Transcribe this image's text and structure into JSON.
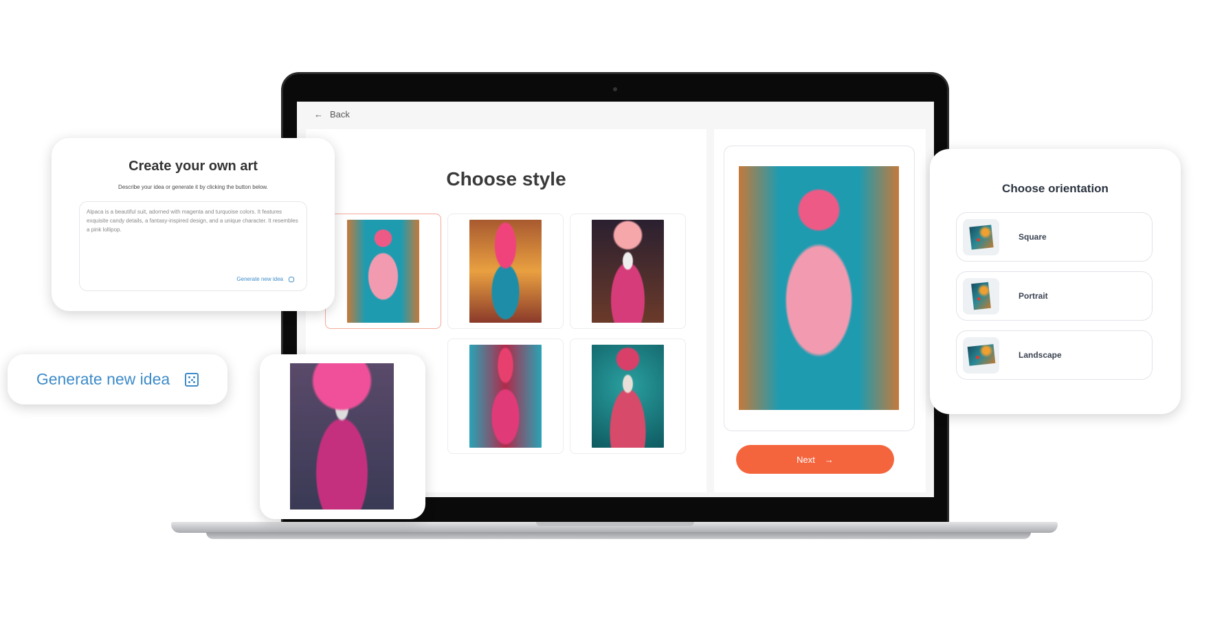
{
  "screen": {
    "back_label": "Back",
    "title": "Choose style",
    "styles": [
      {
        "name": "Candy shop pink alpaca",
        "selected": true
      },
      {
        "name": "Ice cream alpaca in teal suit",
        "selected": false
      },
      {
        "name": "Fluffy alpaca in pink coat",
        "selected": false
      },
      {
        "name": "Pink alpaca in street",
        "selected": false
      },
      {
        "name": "Alpaca with rose hat",
        "selected": false
      }
    ],
    "next_label": "Next",
    "accent_color": "#f5653d"
  },
  "create_card": {
    "title": "Create your own art",
    "subtitle": "Describe your idea or generate it by clicking the button below.",
    "prompt_value": "Alpaca is a beautiful suit, adorned with magenta and turquoise colors. It features exquisite candy details, a fantasy-inspired design, and a unique character. It resembles a pink lollipop.",
    "generate_label": "Generate new idea"
  },
  "generate_pill": {
    "label": "Generate new idea",
    "icon": "dice-icon",
    "color": "#3d8bc9"
  },
  "orientation_card": {
    "title": "Choose orientation",
    "options": [
      {
        "label": "Square"
      },
      {
        "label": "Portrait"
      },
      {
        "label": "Landscape"
      }
    ]
  }
}
